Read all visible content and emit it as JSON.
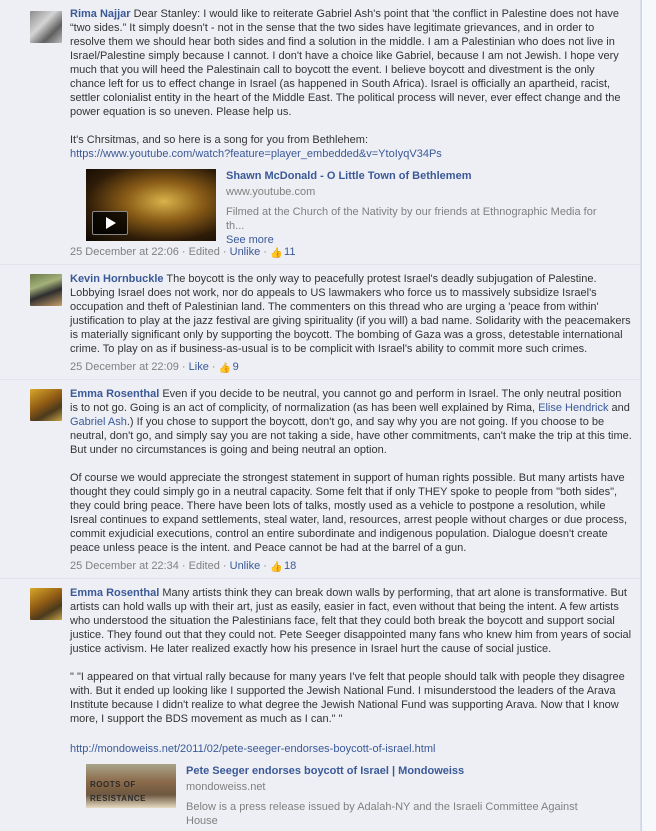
{
  "comments": [
    {
      "author": "Rima Najjar",
      "paragraphs": [
        "Dear Stanley: I would like to reiterate Gabriel Ash's point that 'the conflict in Palestine does not have “two sides.” It simply doesn't - not in the sense that the two sides have legitimate grievances, and in order to resolve them we should hear both sides and find a solution in the middle. I am a Palestinian who does not live in Israel/Palestine simply because I cannot. I don't have a choice like Gabriel, because I am not Jewish. I hope very much that you will heed the Palestinain call to boycott the event. I believe boycott and divestment is the only chance left for us to effect change in Israel (as happened in South Africa). Israel is officially an apartheid, racist, settler colonialist entity in the heart of the Middle East. The political process will never, ever effect change and the power equation is so uneven. Please help us.",
        "It's Chrsitmas, and so here is a song for you from Bethlehem:"
      ],
      "link": "https://www.youtube.com/watch?feature=player_embedded&v=YtoIyqV34Ps",
      "attachment": {
        "title": "Shawn McDonald - O Little Town of Bethlemem",
        "domain": "www.youtube.com",
        "description": "Filmed at the Church of the Nativity by our friends at Ethnographic Media for th...",
        "see_more": "See more"
      },
      "date": "25 December at 22:06",
      "edited": "Edited",
      "action": "Unlike",
      "likes": "11"
    },
    {
      "author": "Kevin Hornbuckle",
      "paragraphs": [
        "The boycott is the only way to peacefully protest Israel's deadly subjugation of Palestine. Lobbying Israel does not work, nor do appeals to US lawmakers who force us to massively subsidize Israel's occupation and theft of Palestinian land. The commenters on this thread who are urging a 'peace from within' justification to play at the jazz festival are giving spirituality (if you will) a bad name. Solidarity with the peacemakers is materially significant only by supporting the boycott. The bombing of Gaza was a gross, detestable international crime. To play on as if business-as-usual is to be complicit with Israel's ability to commit more such crimes."
      ],
      "date": "25 December at 22:09",
      "action": "Like",
      "likes": "9"
    },
    {
      "author": "Emma Rosenthal",
      "p1_a": "Even if you decide to be neutral, you cannot go and perform in Israel. The only neutral position is to not go. Going is an act of complicity, of normalization (as has been well explained by Rima, ",
      "mention1": "Elise Hendrick",
      "p1_b": " and ",
      "mention2": "Gabriel Ash",
      "p1_c": ".) If you chose to support the boycott, don't go, and say why you are not going. If you choose to be neutral, don't go, and simply say you are not taking a side, have other commitments, can't make the trip at this time. But under no circumstances is going and being neutral an option.",
      "p2": "Of course we would appreciate the strongest statement in support of human rights possible. But many artists have thought they could simply go in a neutral capacity. Some felt that if only THEY spoke to people from \"both sides\", they could bring peace. There have been lots of talks, mostly used as a vehicle to postpone a resolution, while Isreal continues to expand settlements, steal water, land, resources, arrest people without charges or due process, commit exjudicial executions, control an entire subordinate and indigenous population. Dialogue doesn't create peace unless peace is the intent. and Peace cannot be had at the barrel of a gun.",
      "date": "25 December at 22:34",
      "edited": "Edited",
      "action": "Unlike",
      "likes": "18"
    },
    {
      "author": "Emma Rosenthal",
      "p1": "Many artists think they can break down walls by performing, that art alone is transformative. But artists can hold walls up with their art, just as easily, easier in fact, even without that being the intent. A few artists who understood the situation the Palestinians face, felt that they could both break the boycott and support social justice. They found out that they could not. Pete Seeger disappointed many fans who knew him from years of social justice activism. He later realized exactly how his presence in Israel hurt the cause of social justice.",
      "quote": "\" \"I appeared on that virtual rally because for many years I've felt that people should talk with people they disagree with. But it ended up looking like I supported the Jewish National Fund. I misunderstood the leaders of the Arava Institute because I didn't realize to what degree the Jewish National Fund was supporting Arava. Now that I know more, I support the BDS movement as much as I can.\" \"",
      "link": "http://mondoweiss.net/2011/02/pete-seeger-endorses-boycott-of-israel.html",
      "attachment": {
        "title": "Pete Seeger endorses boycott of Israel | Mondoweiss",
        "domain": "mondoweiss.net",
        "image_text": "ROOTS OF RESISTANCE",
        "description": "Below is a press release issued by Adalah-NY and the Israeli Committee Against House"
      }
    }
  ]
}
